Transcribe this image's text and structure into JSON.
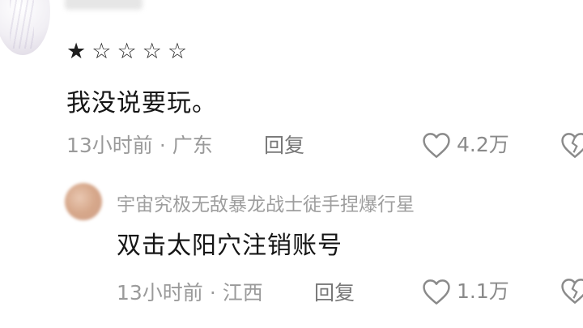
{
  "top_comment": {
    "rating": {
      "stars": [
        "★",
        "☆",
        "☆",
        "☆",
        "☆"
      ],
      "value": 1,
      "max": 5
    },
    "text": "我没说要玩。",
    "time": "13小时前",
    "separator": "·",
    "location": "广东",
    "reply_label": "回复",
    "like_count": "4.2万"
  },
  "reply_comment": {
    "username": "宇宙究极无敌暴龙战士徒手捏爆行星",
    "text": "双击太阳穴注销账号",
    "time": "13小时前",
    "separator": "·",
    "location": "江西",
    "reply_label": "回复",
    "like_count": "1.1万"
  },
  "icons": {
    "like": "heart-outline-icon",
    "dislike": "broken-heart-icon"
  },
  "colors": {
    "text_primary": "#161616",
    "text_secondary": "#9a9a9a",
    "background": "#ffffff"
  }
}
